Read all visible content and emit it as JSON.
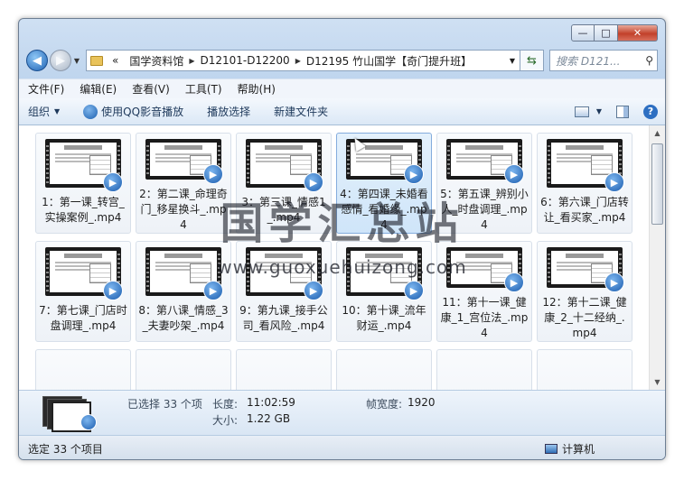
{
  "window": {
    "minimize_glyph": "—",
    "maximize_glyph": "□",
    "close_glyph": "✕"
  },
  "nav": {
    "back_glyph": "◀",
    "forward_glyph": "▶",
    "history_glyph": "▼",
    "address_lead": "«",
    "breadcrumb": [
      "国学资料馆",
      "D12101-D12200",
      "D12195 竹山国学【奇门提升班】"
    ],
    "separator": "▶",
    "dropdown_glyph": "▼",
    "refresh_glyph": "⇆",
    "search_placeholder": "搜索 D121...",
    "search_glyph": "⚲"
  },
  "menu": [
    "文件(F)",
    "编辑(E)",
    "查看(V)",
    "工具(T)",
    "帮助(H)"
  ],
  "commands": {
    "organize": "组织",
    "play_qq": "使用QQ影音播放",
    "play_selection": "播放选择",
    "new_folder": "新建文件夹",
    "dropdown_glyph": "▼",
    "help_glyph": "?"
  },
  "files": [
    {
      "name": "1：第一课_转宫_实操案例_.mp4"
    },
    {
      "name": "2：第二课_命理奇门_移星换斗_.mp4"
    },
    {
      "name": "3：第三课_情感1_.mp4"
    },
    {
      "name": "4：第四课_未婚看感情_看婚缘_.mp4"
    },
    {
      "name": "5：第五课_辨别小人_时盘调理_.mp4"
    },
    {
      "name": "6：第六课_门店转让_看买家_.mp4"
    },
    {
      "name": "7：第七课_门店时盘调理_.mp4"
    },
    {
      "name": "8：第八课_情感_3_夫妻吵架_.mp4"
    },
    {
      "name": "9：第九课_接手公司_看风险_.mp4"
    },
    {
      "name": "10：第十课_流年财运_.mp4"
    },
    {
      "name": "11：第十一课_健康_1_宫位法_.mp4"
    },
    {
      "name": "12：第十二课_健康_2_十二经纳_.mp4"
    }
  ],
  "details": {
    "selected": "已选择 33 个项",
    "length_label": "长度:",
    "length_value": "11:02:59",
    "size_label": "大小:",
    "size_value": "1.22 GB",
    "frame_width_label": "帧宽度:",
    "frame_width_value": "1920"
  },
  "status": {
    "left": "选定 33 个项目",
    "right": "计算机"
  },
  "watermark": {
    "title": "国学汇总站",
    "url": "www.guoxuehuizong.com"
  },
  "scroll": {
    "up_glyph": "▲",
    "down_glyph": "▼"
  }
}
